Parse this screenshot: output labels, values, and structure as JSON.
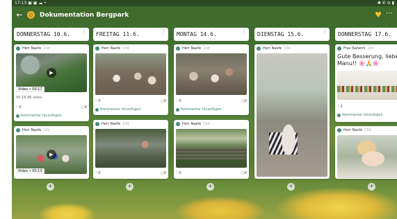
{
  "status": {
    "time": "17:13",
    "left_icons": "▣ ▣ ☁ •",
    "right_icons": "✱ ✆ ⊘ ▮"
  },
  "appbar": {
    "title": "Dokumentation Bergpark",
    "back": "←",
    "more": "⋯",
    "heart": "♥"
  },
  "columns": [
    {
      "title": "DONNERSTAG 10.6."
    },
    {
      "title": "FREITAG 11.6."
    },
    {
      "title": "MONTAG 14.6."
    },
    {
      "title": "DIENSTAG 15.6."
    },
    {
      "title": "DONNERSTAG 17.6."
    }
  ],
  "cards": {
    "c1a": {
      "author": "Herr Naefe",
      "when": "10d",
      "badge": "Video • 00:17",
      "meta": "00:16.98 video",
      "likes": "0",
      "comments": "0",
      "comment_prompt": "Kommentar hinzufügen"
    },
    "c1b": {
      "author": "Herr Naefe",
      "when": "10d",
      "badge": "Video • 00:13",
      "likes": "0",
      "comments": "0"
    },
    "c2a": {
      "author": "Herr Naefe",
      "when": "10d",
      "likes": "0",
      "comments": "0",
      "comment_prompt": "Kommentar hinzufügen"
    },
    "c2b": {
      "author": "Herr Naefe",
      "when": "10d",
      "likes": "0",
      "comments": "0"
    },
    "c3a": {
      "author": "Herr Naefe",
      "when": "10d",
      "likes": "0",
      "comments": "0",
      "comment_prompt": "Kommentar hinzufügen"
    },
    "c3b": {
      "author": "Herr Naefe",
      "when": "10d",
      "likes": "0",
      "comments": "0"
    },
    "c4a": {
      "author": "Herr Naefe",
      "when": "10d"
    },
    "c5a": {
      "author": "Frau Rahemi",
      "when": "10h",
      "text": "Gute Besserung, lieber Manu!! 🌸🙏🌸",
      "likes": "2",
      "comments": "0",
      "comment_prompt": "Kommentar hinzufügen"
    },
    "c5b": {
      "author": "Herr Naefe",
      "when": "10d"
    }
  },
  "add_label": "+",
  "colors": {
    "appbar": "#3e6a2c",
    "accent": "#f2c12e"
  }
}
